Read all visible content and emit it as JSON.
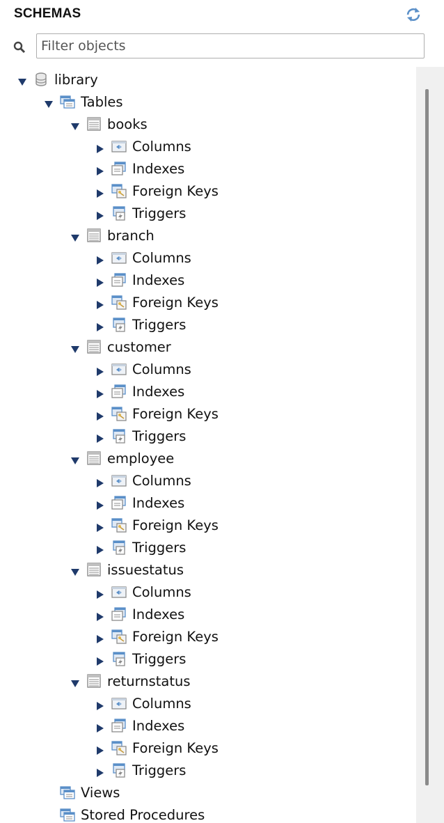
{
  "header": {
    "title": "SCHEMAS"
  },
  "filter": {
    "placeholder": "Filter objects"
  },
  "tree": {
    "schema": {
      "name": "library",
      "expanded": true
    },
    "tables_group": {
      "label": "Tables",
      "expanded": true
    },
    "tables": [
      "books",
      "branch",
      "customer",
      "employee",
      "issuestatus",
      "returnstatus"
    ],
    "subnodes": [
      "Columns",
      "Indexes",
      "Foreign Keys",
      "Triggers"
    ],
    "other_groups": [
      "Views",
      "Stored Procedures"
    ]
  },
  "icons": {
    "schema": "database-icon",
    "group": "folder-table-icon",
    "table": "table-icon",
    "columns": "columns-icon",
    "indexes": "indexes-icon",
    "foreign_keys": "foreign-keys-icon",
    "triggers": "triggers-icon",
    "refresh": "refresh-icon",
    "search": "search-icon"
  },
  "colors": {
    "icon_blue": "#5a8fc8",
    "icon_gray": "#8c8c8c",
    "twisty": "#1f3a6b",
    "border": "#aeaeae"
  }
}
